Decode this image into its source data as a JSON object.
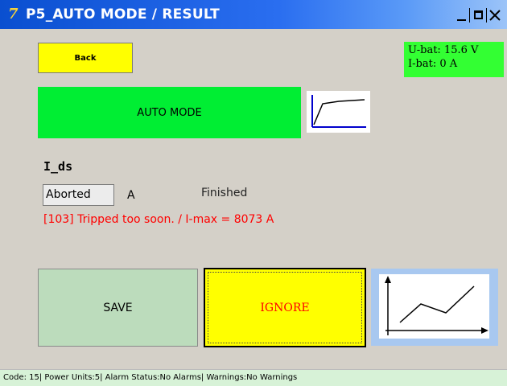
{
  "window": {
    "title": "P5_AUTO MODE / RESULT",
    "app_icon": "7"
  },
  "back_button": {
    "label": "Back"
  },
  "battery": {
    "voltage": "U-bat: 15.6 V",
    "current": "I-bat: 0 A"
  },
  "auto_mode_button": {
    "label": "AUTO MODE"
  },
  "measurement": {
    "label": "I_ds",
    "value": "Aborted",
    "unit": "A",
    "status": "Finished",
    "error": "[103] Tripped too soon. / I-max = 8073 A"
  },
  "actions": {
    "save_label": "SAVE",
    "ignore_label": "IGNORE"
  },
  "statusbar": {
    "text": "Code: 15| Power Units:5| Alarm Status:No Alarms| Warnings:No Warnings"
  },
  "colors": {
    "title_bar": "#0a4fd0",
    "back_button": "#ffff00",
    "battery_box": "#33ff33",
    "auto_mode": "#00ee33",
    "save": "#bcdcbc",
    "ignore": "#ffff00",
    "error_text": "#ff0000",
    "statusbar": "#d7f2d7"
  },
  "icons": {
    "curve_thumbnail": "curve-graph-icon",
    "graph_button": "line-chart-icon",
    "minimize": "minimize-icon",
    "maximize": "maximize-icon",
    "close": "close-icon"
  }
}
